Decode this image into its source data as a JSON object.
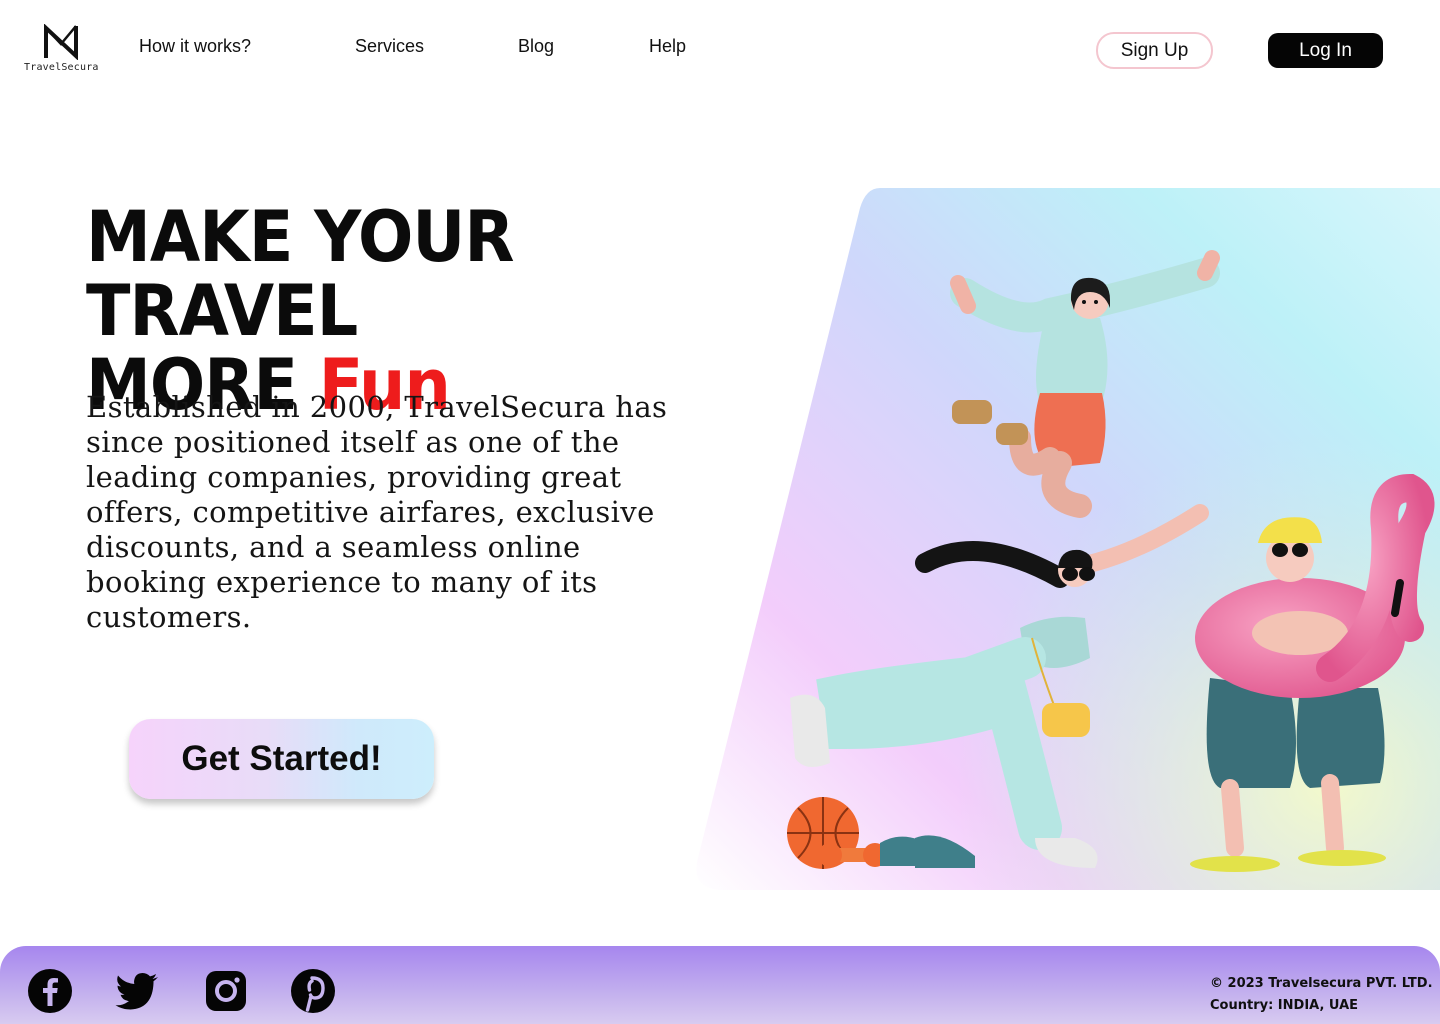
{
  "header": {
    "logo_text": "TravelSecura",
    "nav": [
      "How it works?",
      "Services",
      "Blog",
      "Help"
    ],
    "signup_label": "Sign Up",
    "login_label": "Log In"
  },
  "hero": {
    "title_line1": "Make your travel",
    "title_line2_prefix": "More ",
    "title_highlight": "Fun",
    "description": "Established in 2000, TravelSecura has since positioned itself as one of the leading companies, providing great offers, competitive airfares, exclusive discounts, and a seamless online booking experience to many of its customers.",
    "cta_label": "Get Started!"
  },
  "footer": {
    "social_icons": [
      "facebook-icon",
      "twitter-icon",
      "instagram-icon",
      "pinterest-icon"
    ],
    "copyright": "© 2023 Travelsecura PVT. LTD.",
    "country": "Country: INDIA, UAE"
  },
  "colors": {
    "accent_red": "#ee1c1c",
    "login_bg": "#050505",
    "signup_border": "#f4c6cf",
    "footer_gradient_top": "#a686ee",
    "footer_gradient_bottom": "#d8cbf0"
  }
}
